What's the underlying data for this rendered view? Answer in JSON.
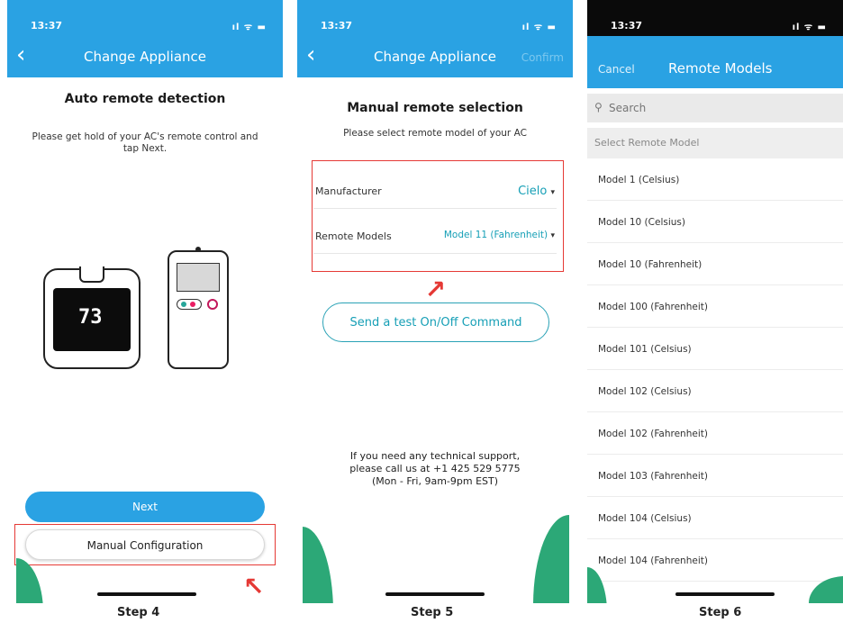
{
  "step4": {
    "status_time": "13:37",
    "status_icons": "ıl ᯤ ▬",
    "nav_title": "Change Appliance",
    "heading": "Auto remote detection",
    "subtext": "Please get hold of your AC's remote control and tap Next.",
    "thermostat_temp": "73",
    "next_label": "Next",
    "manual_label": "Manual Configuration",
    "step_label": "Step 4"
  },
  "step5": {
    "status_time": "13:37",
    "status_icons": "ıl ᯤ ▬",
    "nav_title": "Change Appliance",
    "confirm_label": "Confirm",
    "heading": "Manual remote selection",
    "subtext": "Please select remote model of your AC",
    "manufacturer_label": "Manufacturer",
    "manufacturer_value": "Cielo",
    "remote_models_label": "Remote Models",
    "remote_models_value": "Model 11 (Fahrenheit)",
    "test_button_label": "Send a test On/Off Command",
    "support_line1": "If you need any technical support,",
    "support_line2": "please call us at +1 425 529 5775",
    "support_line3": "(Mon - Fri, 9am-9pm EST)",
    "step_label": "Step 5"
  },
  "step6": {
    "status_time": "13:37",
    "status_icons": "ıl ᯤ ▬",
    "cancel_label": "Cancel",
    "nav_title": "Remote Models",
    "search_placeholder": "Search",
    "section_header": "Select Remote Model",
    "models": [
      "Model 1 (Celsius)",
      "Model 10 (Celsius)",
      "Model 10 (Fahrenheit)",
      "Model 100 (Fahrenheit)",
      "Model 101 (Celsius)",
      "Model 102 (Celsius)",
      "Model 102 (Fahrenheit)",
      "Model 103 (Fahrenheit)",
      "Model 104 (Celsius)",
      "Model 104 (Fahrenheit)"
    ],
    "step_label": "Step 6"
  },
  "colors": {
    "primary_blue": "#2aa2e3",
    "teal_text": "#169fb6",
    "highlight_red": "#e53935",
    "leaf_green": "#2ca877"
  }
}
